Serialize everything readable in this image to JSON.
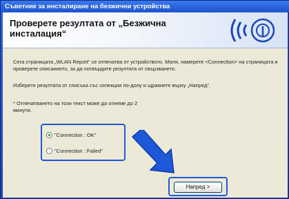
{
  "window": {
    "title": "Съветник за инсталиране на безжични устройства"
  },
  "header": {
    "title": "Проверете резултата от „Безжична инсталация“"
  },
  "content": {
    "paragraph1": "Сега страницата „WLAN Report“ се отпечатва от устройството. Моля, намерете <Connection> на страницата и проверете описанието, за да потвърдите резултата от свързването.",
    "paragraph2": "Изберете резултата от списъка със селекции по-долу и щракнете върху „Напред“.",
    "note": "* Отпечатването на този текст може да отнеме до 2 минути."
  },
  "options": [
    {
      "label": "\"Connection : OK\"",
      "selected": true
    },
    {
      "label": "\"Connection : Failed\"",
      "selected": false
    }
  ],
  "buttons": {
    "next_label": "Напред >"
  },
  "colors": {
    "highlight": "#1d58d9",
    "titlebar": "#2a63dc",
    "content_bg": "#ece9d8"
  }
}
